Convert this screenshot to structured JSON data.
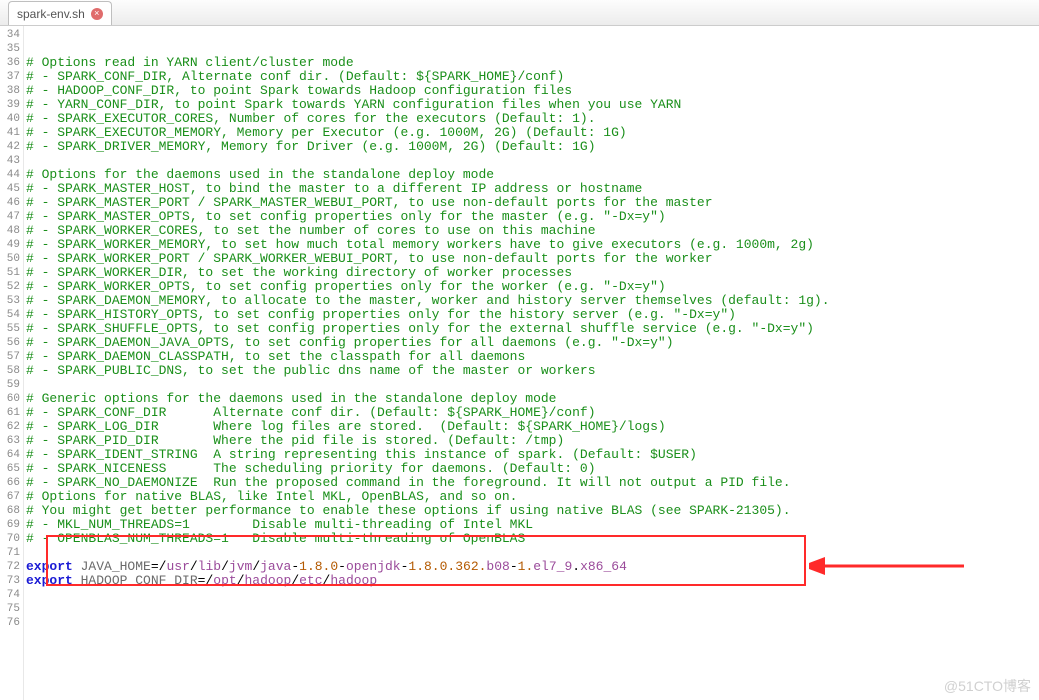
{
  "tab": {
    "filename": "spark-env.sh"
  },
  "gutter": {
    "start": 34,
    "end": 76
  },
  "lines": [
    {
      "type": "comment",
      "text": "# Options read in YARN client/cluster mode"
    },
    {
      "type": "comment",
      "text": "# - SPARK_CONF_DIR, Alternate conf dir. (Default: ${SPARK_HOME}/conf)"
    },
    {
      "type": "comment",
      "text": "# - HADOOP_CONF_DIR, to point Spark towards Hadoop configuration files"
    },
    {
      "type": "comment",
      "text": "# - YARN_CONF_DIR, to point Spark towards YARN configuration files when you use YARN"
    },
    {
      "type": "comment",
      "text": "# - SPARK_EXECUTOR_CORES, Number of cores for the executors (Default: 1)."
    },
    {
      "type": "comment",
      "text": "# - SPARK_EXECUTOR_MEMORY, Memory per Executor (e.g. 1000M, 2G) (Default: 1G)"
    },
    {
      "type": "comment",
      "text": "# - SPARK_DRIVER_MEMORY, Memory for Driver (e.g. 1000M, 2G) (Default: 1G)"
    },
    {
      "type": "blank",
      "text": ""
    },
    {
      "type": "comment",
      "text": "# Options for the daemons used in the standalone deploy mode"
    },
    {
      "type": "comment",
      "text": "# - SPARK_MASTER_HOST, to bind the master to a different IP address or hostname"
    },
    {
      "type": "comment",
      "text": "# - SPARK_MASTER_PORT / SPARK_MASTER_WEBUI_PORT, to use non-default ports for the master"
    },
    {
      "type": "comment",
      "text": "# - SPARK_MASTER_OPTS, to set config properties only for the master (e.g. \"-Dx=y\")"
    },
    {
      "type": "comment",
      "text": "# - SPARK_WORKER_CORES, to set the number of cores to use on this machine"
    },
    {
      "type": "comment",
      "text": "# - SPARK_WORKER_MEMORY, to set how much total memory workers have to give executors (e.g. 1000m, 2g)"
    },
    {
      "type": "comment",
      "text": "# - SPARK_WORKER_PORT / SPARK_WORKER_WEBUI_PORT, to use non-default ports for the worker"
    },
    {
      "type": "comment",
      "text": "# - SPARK_WORKER_DIR, to set the working directory of worker processes"
    },
    {
      "type": "comment",
      "text": "# - SPARK_WORKER_OPTS, to set config properties only for the worker (e.g. \"-Dx=y\")"
    },
    {
      "type": "comment",
      "text": "# - SPARK_DAEMON_MEMORY, to allocate to the master, worker and history server themselves (default: 1g)."
    },
    {
      "type": "comment",
      "text": "# - SPARK_HISTORY_OPTS, to set config properties only for the history server (e.g. \"-Dx=y\")"
    },
    {
      "type": "comment",
      "text": "# - SPARK_SHUFFLE_OPTS, to set config properties only for the external shuffle service (e.g. \"-Dx=y\")"
    },
    {
      "type": "comment",
      "text": "# - SPARK_DAEMON_JAVA_OPTS, to set config properties for all daemons (e.g. \"-Dx=y\")"
    },
    {
      "type": "comment",
      "text": "# - SPARK_DAEMON_CLASSPATH, to set the classpath for all daemons"
    },
    {
      "type": "comment",
      "text": "# - SPARK_PUBLIC_DNS, to set the public dns name of the master or workers"
    },
    {
      "type": "blank",
      "text": ""
    },
    {
      "type": "comment",
      "text": "# Generic options for the daemons used in the standalone deploy mode"
    },
    {
      "type": "comment",
      "text": "# - SPARK_CONF_DIR      Alternate conf dir. (Default: ${SPARK_HOME}/conf)"
    },
    {
      "type": "comment",
      "text": "# - SPARK_LOG_DIR       Where log files are stored.  (Default: ${SPARK_HOME}/logs)"
    },
    {
      "type": "comment",
      "text": "# - SPARK_PID_DIR       Where the pid file is stored. (Default: /tmp)"
    },
    {
      "type": "comment",
      "text": "# - SPARK_IDENT_STRING  A string representing this instance of spark. (Default: $USER)"
    },
    {
      "type": "comment",
      "text": "# - SPARK_NICENESS      The scheduling priority for daemons. (Default: 0)"
    },
    {
      "type": "comment",
      "text": "# - SPARK_NO_DAEMONIZE  Run the proposed command in the foreground. It will not output a PID file."
    },
    {
      "type": "comment",
      "text": "# Options for native BLAS, like Intel MKL, OpenBLAS, and so on."
    },
    {
      "type": "comment",
      "text": "# You might get better performance to enable these options if using native BLAS (see SPARK-21305)."
    },
    {
      "type": "comment",
      "text": "# - MKL_NUM_THREADS=1        Disable multi-threading of Intel MKL"
    },
    {
      "type": "comment",
      "text": "# - OPENBLAS_NUM_THREADS=1   Disable multi-threading of OpenBLAS"
    },
    {
      "type": "blank",
      "text": ""
    },
    {
      "type": "export",
      "kw": "export",
      "var": "JAVA_HOME",
      "eq": "=",
      "segs": [
        "/",
        "usr",
        "/",
        "lib",
        "/",
        "jvm",
        "/",
        "java",
        "-",
        "1.8.0",
        "-",
        "openjdk",
        "-",
        "1.8.0.362.",
        "b08",
        "-",
        "1.",
        "el7_9",
        ".",
        "x86_64"
      ]
    },
    {
      "type": "export",
      "kw": "export",
      "var": "HADOOP_CONF_DIR",
      "eq": "=",
      "segs": [
        "/",
        "opt",
        "/",
        "hadoop",
        "/",
        "etc",
        "/",
        "hadoop"
      ]
    },
    {
      "type": "blank",
      "text": ""
    },
    {
      "type": "blank",
      "text": ""
    },
    {
      "type": "blank",
      "text": ""
    },
    {
      "type": "blank",
      "text": ""
    },
    {
      "type": "blank",
      "text": ""
    }
  ],
  "watermark": "@51CTO博客"
}
